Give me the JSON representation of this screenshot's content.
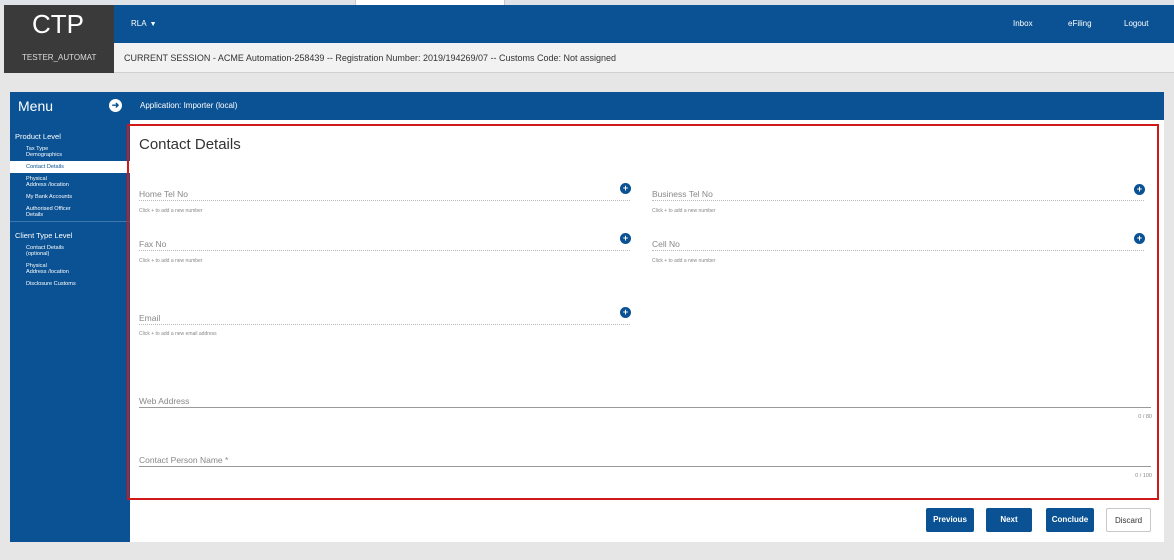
{
  "app": {
    "logo": "CTP",
    "user": "TESTER_AUTOMAT",
    "account_menu": "RLA",
    "top_links": [
      "Inbox",
      "eFiling",
      "Logout"
    ],
    "session": "CURRENT SESSION - ACME Automation-258439 -- Registration Number: 2019/194269/07 -- Customs Code: Not assigned"
  },
  "menu": {
    "title": "Menu",
    "sections": [
      {
        "title": "Product Level",
        "items": [
          "Tax Type\nDemographics",
          "Contact Details",
          "Physical\nAddress /location",
          "My Bank Accounts",
          "Authorised Officer\nDetails"
        ]
      },
      {
        "title": "Client Type Level",
        "items": [
          "Contact Details\n(optional)",
          "Physical\nAddress /location",
          "Disclosure Customs"
        ]
      }
    ],
    "active_item": "Contact Details"
  },
  "application_label": "Application: Importer (local)",
  "page_title": "Contact Details",
  "form": {
    "home_tel": {
      "label": "Home Tel No",
      "hint": "Click + to add a new number"
    },
    "business_tel": {
      "label": "Business Tel No",
      "hint": "Click + to add a new number"
    },
    "fax": {
      "label": "Fax No",
      "hint": "Click + to add a new number"
    },
    "cell": {
      "label": "Cell No",
      "hint": "Click + to add a new number"
    },
    "email": {
      "label": "Email",
      "hint": "Click + to add a new email address"
    },
    "web_address": {
      "label": "Web Address",
      "counter": "0 / 80"
    },
    "contact_person": {
      "label": "Contact Person Name *",
      "counter": "0 / 100"
    }
  },
  "buttons": {
    "previous": "Previous",
    "next": "Next",
    "conclude": "Conclude",
    "discard": "Discard"
  },
  "colors": {
    "primary": "#0a5293",
    "highlight": "#d11818",
    "dark": "#3a3a3a"
  },
  "icons": {
    "add": "plus-circle-icon",
    "menu_toggle": "arrow-circle-icon",
    "dropdown": "caret-down-icon"
  }
}
